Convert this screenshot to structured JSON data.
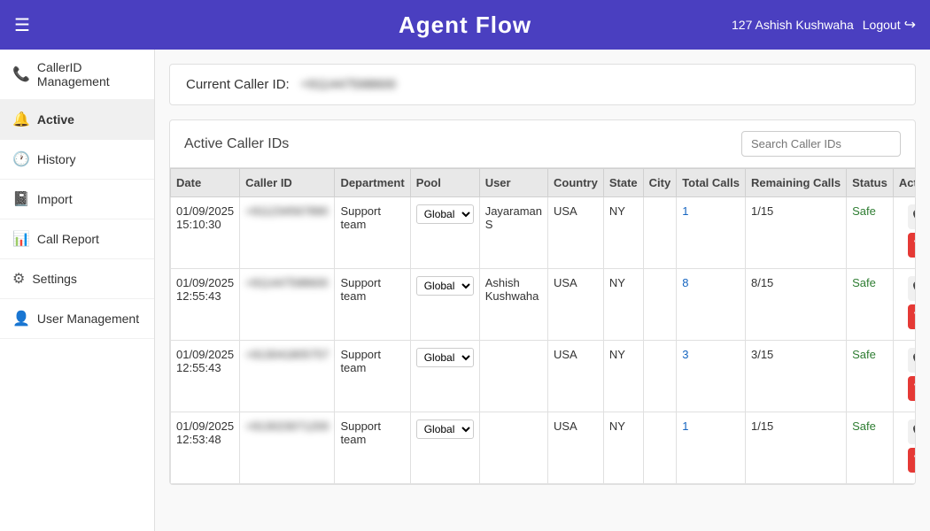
{
  "header": {
    "menu_icon": "☰",
    "title": "Agent Flow",
    "user": "127 Ashish Kushwaha",
    "logout_label": "Logout",
    "logout_icon": "⬛"
  },
  "sidebar": {
    "items": [
      {
        "id": "caller-id-management",
        "label": "CallerID Management",
        "icon": "📞"
      },
      {
        "id": "active",
        "label": "Active",
        "icon": "🔔"
      },
      {
        "id": "history",
        "label": "History",
        "icon": "🕐"
      },
      {
        "id": "import",
        "label": "Import",
        "icon": "📓"
      },
      {
        "id": "call-report",
        "label": "Call Report",
        "icon": "📊"
      },
      {
        "id": "settings",
        "label": "Settings",
        "icon": "⚙"
      },
      {
        "id": "user-management",
        "label": "User Management",
        "icon": "👤"
      }
    ]
  },
  "main": {
    "current_caller_id_label": "Current Caller ID:",
    "current_caller_id_value": "+911447598600",
    "table_title": "Active Caller IDs",
    "search_placeholder": "Search Caller IDs",
    "columns": [
      "Date",
      "Caller ID",
      "Department",
      "Pool",
      "User",
      "Country",
      "State",
      "City",
      "Total Calls",
      "Remaining Calls",
      "Status",
      "Actions"
    ],
    "rows": [
      {
        "date": "01/09/2025 15:10:30",
        "caller_id": "+911234567890",
        "department": "Support team",
        "pool": "Global",
        "user": "Jayaraman S",
        "country": "USA",
        "state": "NY",
        "city": "",
        "total_calls": "1",
        "remaining_calls": "1/15",
        "status": "Safe"
      },
      {
        "date": "01/09/2025 12:55:43",
        "caller_id": "+911447598600",
        "department": "Support team",
        "pool": "Global",
        "user": "Ashish Kushwaha",
        "country": "USA",
        "state": "NY",
        "city": "",
        "total_calls": "8",
        "remaining_calls": "8/15",
        "status": "Safe"
      },
      {
        "date": "01/09/2025 12:55:43",
        "caller_id": "+913041805757",
        "department": "Support team",
        "pool": "Global",
        "user": "",
        "country": "USA",
        "state": "NY",
        "city": "",
        "total_calls": "3",
        "remaining_calls": "3/15",
        "status": "Safe"
      },
      {
        "date": "01/09/2025 12:53:48",
        "caller_id": "+913023071200",
        "department": "Support team",
        "pool": "Global",
        "user": "",
        "country": "USA",
        "state": "NY",
        "city": "",
        "total_calls": "1",
        "remaining_calls": "1/15",
        "status": "Safe"
      }
    ]
  }
}
